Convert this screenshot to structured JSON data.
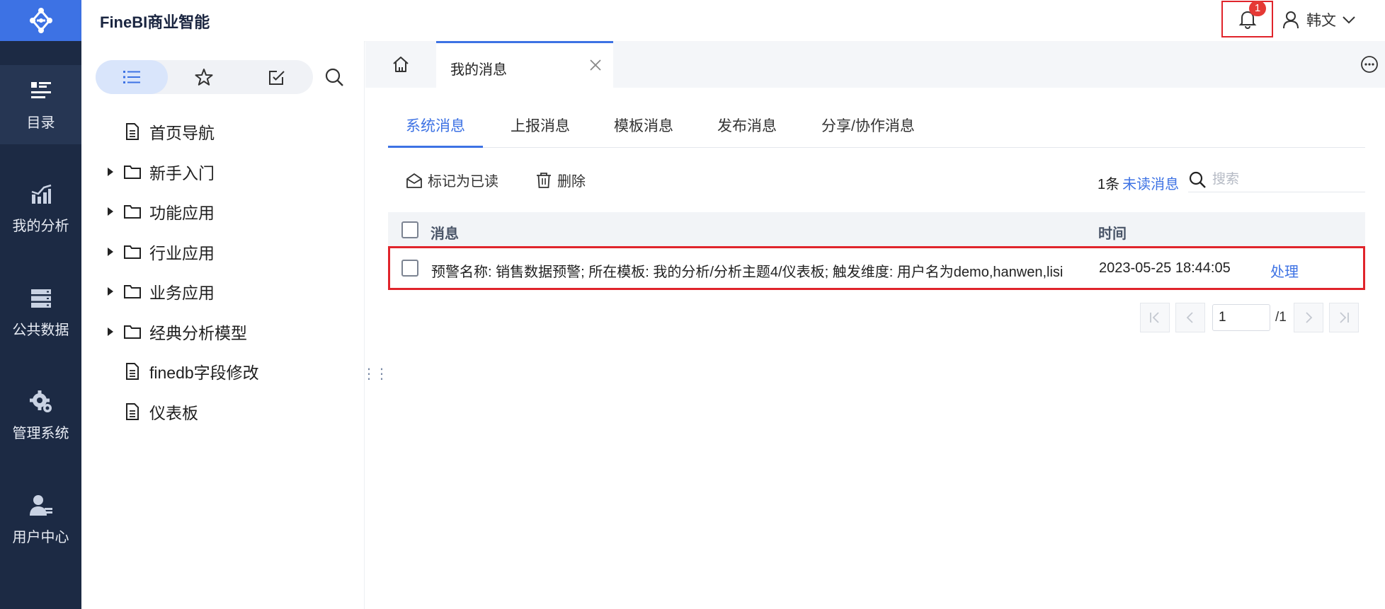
{
  "app": {
    "title": "FineBI商业智能"
  },
  "colors": {
    "rail_bg": "#1c2a44",
    "accent": "#3d72e4",
    "highlight_border": "#e0242b",
    "badge": "#e53935"
  },
  "rail": {
    "items": [
      {
        "label": "目录",
        "icon": "catalog-icon",
        "active": true
      },
      {
        "label": "我的分析",
        "icon": "analysis-chart-icon",
        "active": false
      },
      {
        "label": "公共数据",
        "icon": "public-data-icon",
        "active": false
      },
      {
        "label": "管理系统",
        "icon": "gear-icon",
        "active": false
      },
      {
        "label": "用户中心",
        "icon": "user-center-icon",
        "active": false
      }
    ]
  },
  "header": {
    "notification_count": "1",
    "user_name": "韩文"
  },
  "directory": {
    "tree": [
      {
        "label": "首页导航",
        "type": "file",
        "expandable": false
      },
      {
        "label": "新手入门",
        "type": "folder",
        "expandable": true
      },
      {
        "label": "功能应用",
        "type": "folder",
        "expandable": true
      },
      {
        "label": "行业应用",
        "type": "folder",
        "expandable": true
      },
      {
        "label": "业务应用",
        "type": "folder",
        "expandable": true
      },
      {
        "label": "经典分析模型",
        "type": "folder",
        "expandable": true
      },
      {
        "label": "finedb字段修改",
        "type": "file",
        "expandable": false
      },
      {
        "label": "仪表板",
        "type": "file",
        "expandable": false
      }
    ]
  },
  "tabs": {
    "open_tab": "我的消息"
  },
  "messages": {
    "subtabs": [
      "系统消息",
      "上报消息",
      "模板消息",
      "发布消息",
      "分享/协作消息"
    ],
    "active_subtab": 0,
    "toolbar": {
      "mark_read": "标记为已读",
      "delete": "删除"
    },
    "unread_count": "1条",
    "unread_link": "未读消息",
    "search_placeholder": "搜索",
    "columns": {
      "message": "消息",
      "time": "时间"
    },
    "rows": [
      {
        "message": "预警名称: 销售数据预警; 所在模板: 我的分析/分析主题4/仪表板; 触发维度: 用户名为demo,hanwen,lisi",
        "time": "2023-05-25 18:44:05",
        "action": "处理"
      }
    ],
    "pagination": {
      "current_page": "1",
      "total": "/1"
    }
  }
}
